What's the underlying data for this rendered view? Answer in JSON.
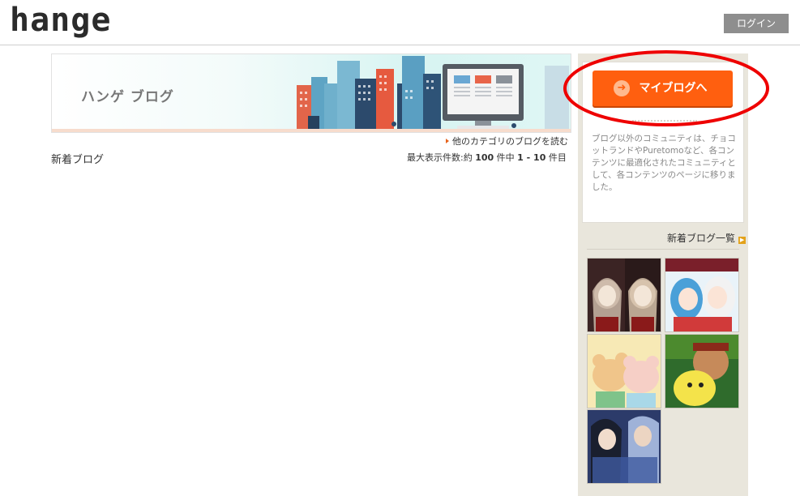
{
  "header": {
    "logo": "hange",
    "login_label": "ログイン"
  },
  "banner": {
    "title": "ハンゲ ブログ"
  },
  "main": {
    "other_category_link": "他のカテゴリのブログを読む",
    "new_blog_label": "新着ブログ",
    "max_display": {
      "prefix": "最大表示件数:約 ",
      "count": "100",
      "middle": " 件中 ",
      "range": "1 - 10",
      "suffix": " 件目"
    }
  },
  "sidebar": {
    "myblog_button_label": "マイブログへ",
    "description": "ブログ以外のコミュニティは、チョコットランドやPuretomoなど、各コンテンツに最適化されたコミュニティとして、各コンテンツのページに移りました。",
    "new_blog_list_link": "新着ブログ一覧",
    "thumbnails": [
      {
        "name": "dark-dolls-avatar",
        "colors": [
          "#2a1a1a",
          "#c9b6a6"
        ]
      },
      {
        "name": "anime-girls-avatar",
        "colors": [
          "#e9f3f9",
          "#4aa0d8"
        ]
      },
      {
        "name": "hamsters-avatar",
        "colors": [
          "#f7e9b5",
          "#f0c58a"
        ]
      },
      {
        "name": "warrior-and-chick-avatar",
        "colors": [
          "#2f6b2c",
          "#f4e34a"
        ]
      },
      {
        "name": "fantasy-heroes-avatar",
        "colors": [
          "#2c3b6a",
          "#9fb2d8"
        ]
      }
    ]
  },
  "colors": {
    "accent_orange": "#ff5f0f",
    "highlight_red": "#ee0000",
    "sidebar_bg": "#e9e6dc"
  }
}
